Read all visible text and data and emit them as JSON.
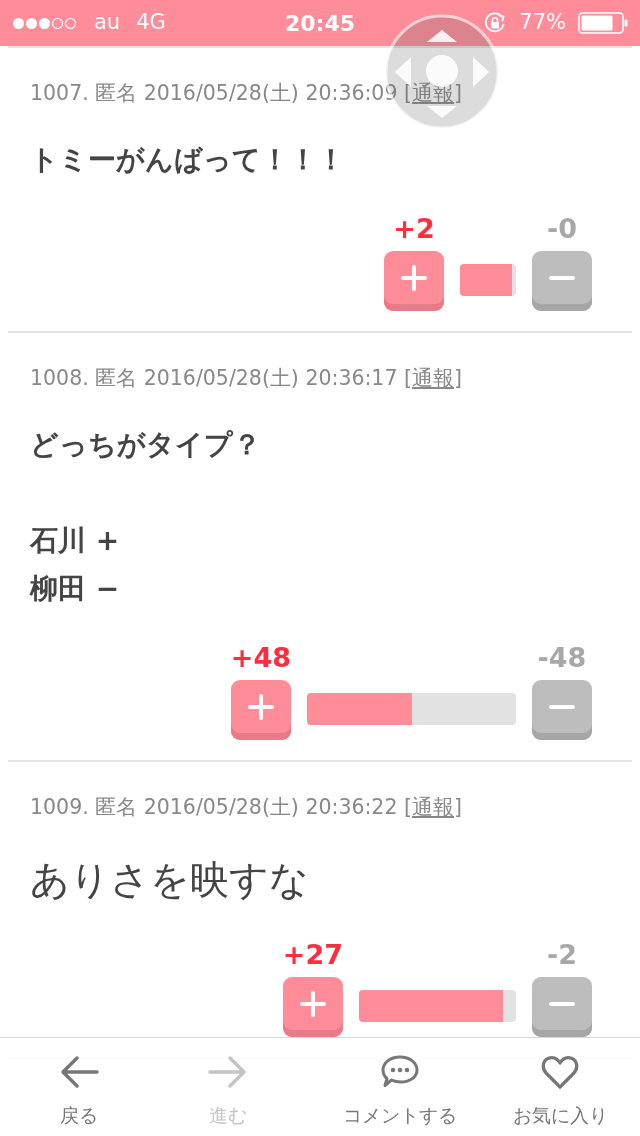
{
  "status_bar": {
    "carrier": "au",
    "network": "4G",
    "time": "20:45",
    "battery": "77%"
  },
  "comments": [
    {
      "header": {
        "text": "1007. 匿名 2016/05/28(土) 20:36:09 [",
        "report_link": "通報",
        "text_after": "]"
      },
      "paragraphs": [
        [
          "トミーがんばって！！！"
        ]
      ],
      "large": false,
      "votes": {
        "plus": "+2",
        "minus": "-0",
        "level": 0.93
      }
    },
    {
      "header": {
        "text": "1008. 匿名 2016/05/28(土) 20:36:17 [",
        "report_link": "通報",
        "text_after": "]"
      },
      "paragraphs": [
        [
          "どっちがタイプ？"
        ],
        [
          "石川 +",
          "柳田 −"
        ]
      ],
      "large": false,
      "votes": {
        "plus": "+48",
        "minus": "-48",
        "level": 0.5
      }
    },
    {
      "header": {
        "text": "1009. 匿名 2016/05/28(土) 20:36:22 [",
        "report_link": "通報",
        "text_after": "]"
      },
      "paragraphs": [
        [
          "ありさを映すな"
        ]
      ],
      "large": true,
      "votes": {
        "plus": "+27",
        "minus": "-2",
        "level": 0.92
      }
    }
  ],
  "toolbar": [
    {
      "kind": "back",
      "label": "戻る",
      "disabled": false
    },
    {
      "kind": "forward",
      "label": "進む",
      "disabled": true
    },
    {
      "kind": "comment",
      "label": "コメントする",
      "disabled": false
    },
    {
      "kind": "favorite",
      "label": "お気に入り",
      "disabled": false
    }
  ]
}
